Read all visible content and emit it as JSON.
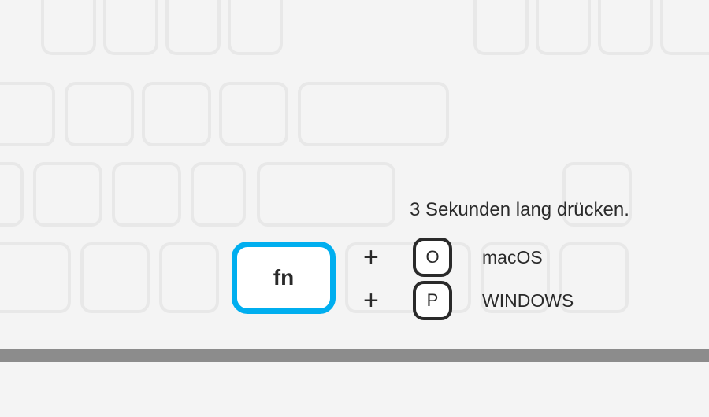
{
  "instruction": "3 Sekunden lang drücken.",
  "fn_label": "fn",
  "plus": "+",
  "rows": [
    {
      "key": "O",
      "os": "macOS"
    },
    {
      "key": "P",
      "os": "WINDOWS"
    }
  ],
  "colors": {
    "accent": "#00aeef"
  }
}
